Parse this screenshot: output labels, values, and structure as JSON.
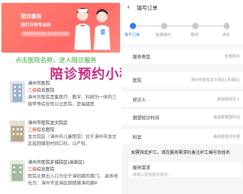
{
  "banner": {
    "line1": "陪诊服务",
    "line2": "我们只有专业的",
    "line3": "医疗资质优质服务 全护理工作经验"
  },
  "promo": "点击医院名称，进入陪诊服务",
  "overlay": "陪诊预约小程序",
  "hospitals": [
    {
      "name": "漳州市医院",
      "level_red": "三级",
      "level_rest": "综合医院",
      "desc": "漳州市医院是集医疗、教学、科研为一体的三级甲等综合性公立医院，是福建医"
    },
    {
      "name": "漳州市医院龙文院区",
      "level_red": "三级",
      "level_rest": "综合医院",
      "desc": "龙文院区（漳州市儿童医院）位于漳州市龙文区蓝田镇田村同口社，以产科、"
    },
    {
      "name": "漳州市医院芗城院区(高新区)",
      "level_red": "三级",
      "level_rest": "综合医院",
      "desc": "医院主要出入口为位于漳码路的南门。 具体地址为：漳州市龙海区颜厝镇漳码路8"
    }
  ],
  "order": {
    "back_icon": "‹",
    "title": "填写订单",
    "steps": [
      "填写订单",
      "在线支付",
      "陪诊",
      "评价"
    ],
    "active_step": 0,
    "fields": [
      {
        "label": "服务类型",
        "value": "全程陪诊"
      },
      {
        "label": "医院",
        "value": "漳州市医院龙文院区(芗城区)"
      },
      {
        "label": "就诊人",
        "value": "请选择就诊人"
      },
      {
        "label": "期望就诊时间",
        "value": "请选择期望时间"
      },
      {
        "label": "科室",
        "value": "请选择就诊科室"
      }
    ],
    "note": "如需指定护工，请在服务需求栏备注护工编号及姓名",
    "requirement_label": "服务需求",
    "requirement_placeholder": "请输入其他服务需求..."
  },
  "colors": {
    "accent": "#2f7cf6",
    "banner": "#ff6a66",
    "promo": "#2fa92f",
    "overlay": "#c8257e",
    "level": "#e02e24"
  }
}
